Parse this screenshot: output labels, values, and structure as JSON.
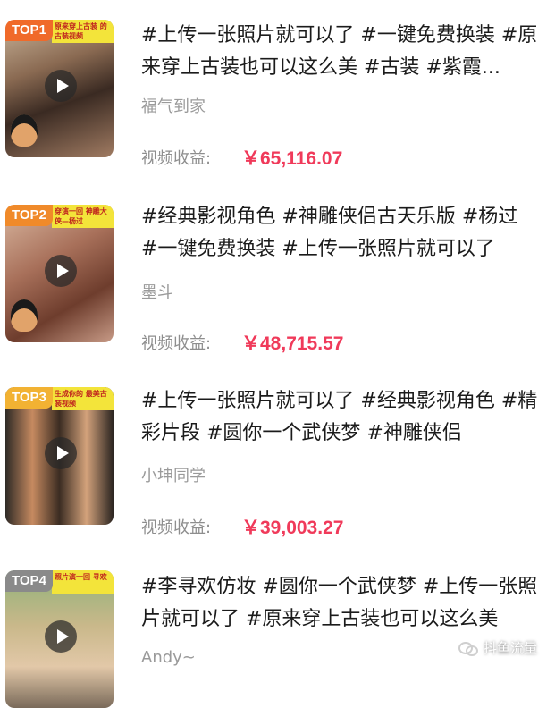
{
  "items": [
    {
      "rank": "TOP1",
      "rank_color": "#f06a2a",
      "caption": "原来穿上古装 的古装视频",
      "title": "#上传一张照片就可以了 #一键免费换装 #原来穿上古装也可以这么美 #古装 #紫霞...",
      "author": "福气到家",
      "earn_label": "视频收益:",
      "earn_value": "￥65,116.07"
    },
    {
      "rank": "TOP2",
      "rank_color": "#f08a2a",
      "caption": "穿演一回 神雕大侠—杨过",
      "title": "#经典影视角色 #神雕侠侣古天乐版 #杨过 #一键免费换装 #上传一张照片就可以了",
      "author": "墨斗",
      "earn_label": "视频收益:",
      "earn_value": "￥48,715.57"
    },
    {
      "rank": "TOP3",
      "rank_color": "#f2b233",
      "caption": "生成你的 最美古装视频",
      "title": "#上传一张照片就可以了 #经典影视角色 #精彩片段 #圆你一个武侠梦 #神雕侠侣",
      "author": "小坤同学",
      "earn_label": "视频收益:",
      "earn_value": "￥39,003.27"
    },
    {
      "rank": "TOP4",
      "rank_color": "#8a8a8a",
      "caption": "照片演一回 寻欢",
      "title": "#李寻欢仿妆 #圆你一个武侠梦 #上传一张照片就可以了 #原来穿上古装也可以这么美",
      "author": "Andy~",
      "earn_label": "",
      "earn_value": ""
    }
  ],
  "watermark": "抖鱼流量"
}
